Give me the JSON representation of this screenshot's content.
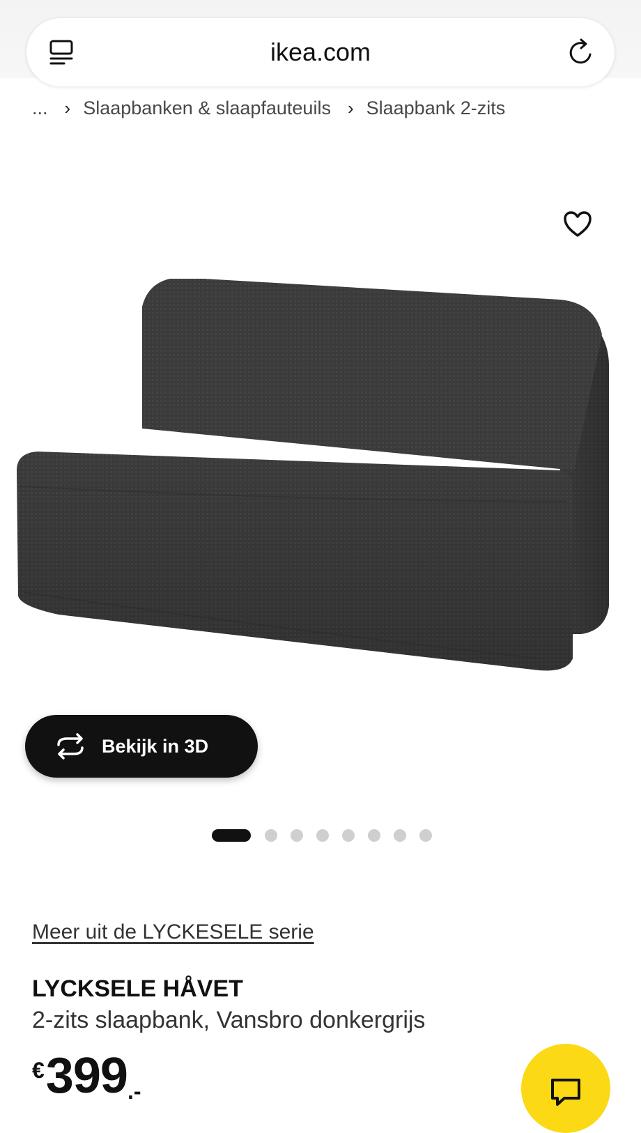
{
  "browser": {
    "url": "ikea.com"
  },
  "breadcrumb": {
    "ellipsis": "...",
    "separator": "›",
    "items": [
      "Slaapbanken & slaapfauteuils",
      "Slaapbank 2-zits"
    ]
  },
  "gallery": {
    "view_3d_label": "Bekijk in 3D",
    "total_images": 8,
    "active_index": 0
  },
  "product": {
    "series_link": "Meer uit de LYCKESELE serie",
    "name": "LYCKSELE HÅVET",
    "description": "2-zits slaapbank, Vansbro donkergrijs",
    "price": {
      "currency": "€",
      "amount": "399",
      "suffix": ".-"
    }
  },
  "colors": {
    "accent_yellow": "#fbd914",
    "button_dark": "#111111",
    "sofa_fabric": "#3b3b3b"
  },
  "icons": {
    "url_menu": "tab-list-icon",
    "reload": "reload-icon",
    "favorite": "heart-icon",
    "view_3d": "rotate-3d-icon",
    "chat": "chat-bubble-icon"
  }
}
